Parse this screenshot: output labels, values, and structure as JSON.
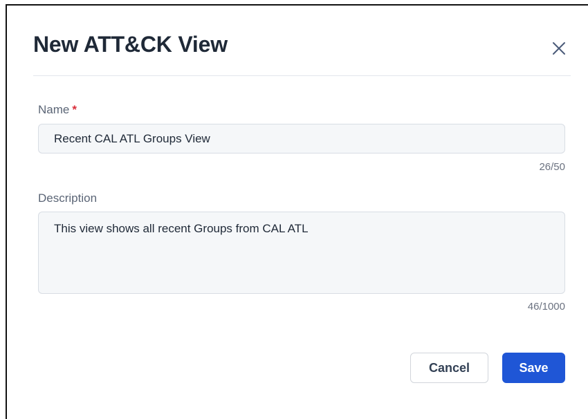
{
  "dialog": {
    "title": "New ATT&CK View",
    "close_icon": "close-icon"
  },
  "form": {
    "name": {
      "label": "Name",
      "required_marker": "*",
      "value": "Recent CAL ATL Groups View",
      "counter": "26/50"
    },
    "description": {
      "label": "Description",
      "value": "This view shows all recent Groups from CAL ATL",
      "counter": "46/1000"
    }
  },
  "actions": {
    "cancel_label": "Cancel",
    "save_label": "Save"
  },
  "colors": {
    "primary": "#1f56d6",
    "required": "#d92d3a",
    "title_text": "#1f2937",
    "muted_text": "#5b6576",
    "field_background": "#f5f7f9"
  }
}
